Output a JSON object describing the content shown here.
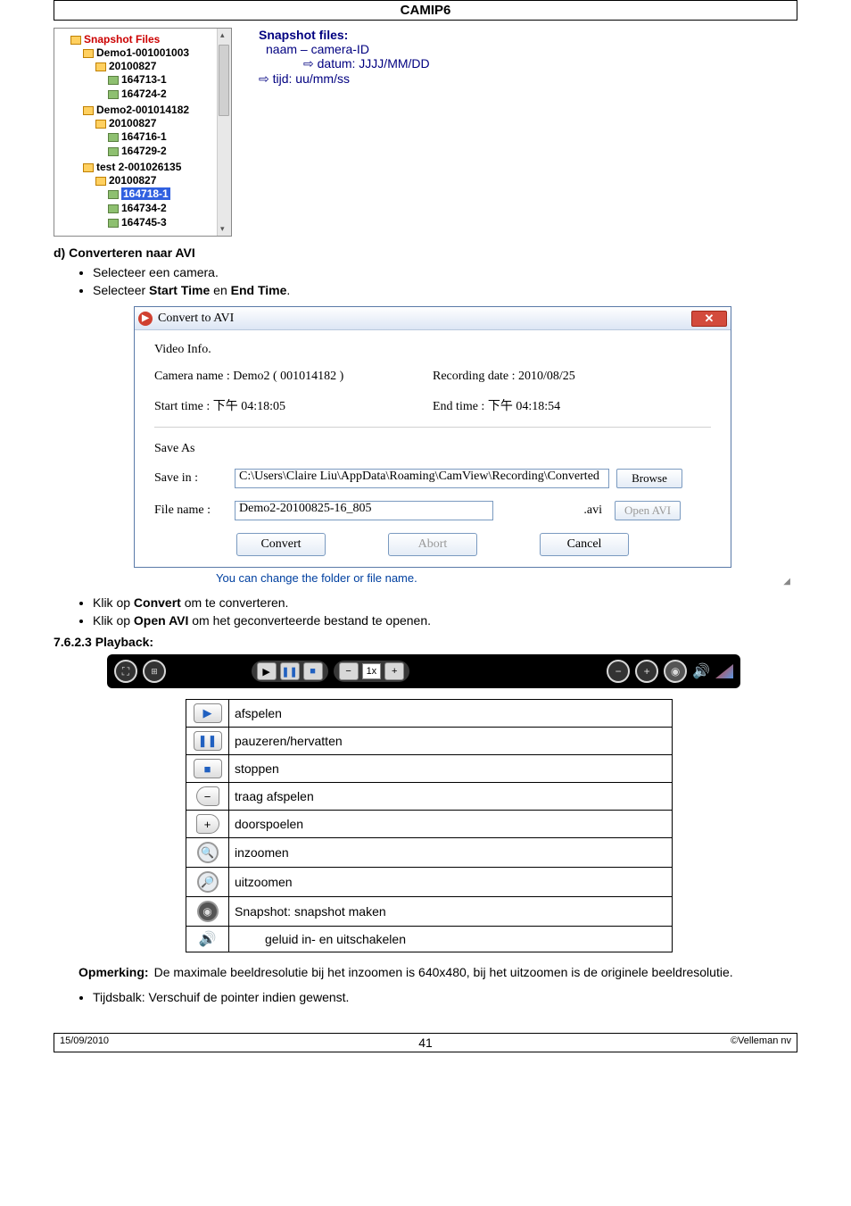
{
  "header": "CAMIP6",
  "tree": {
    "root": "Snapshot Files",
    "nodes": [
      {
        "name": "Demo1-001001003",
        "date": "20100827",
        "files": [
          "164713-1",
          "164724-2"
        ]
      },
      {
        "name": "Demo2-001014182",
        "date": "20100827",
        "files": [
          "164716-1",
          "164729-2"
        ]
      },
      {
        "name": "test 2-001026135",
        "date": "20100827",
        "files": [
          "164718-1",
          "164734-2",
          "164745-3"
        ],
        "selected_file": "164718-1"
      }
    ]
  },
  "snapshot_desc": {
    "title": "Snapshot files:",
    "l1": "naam – camera-ID",
    "l2": "⇨ datum: JJJJ/MM/DD",
    "l3": "⇨ tijd: uu/mm/ss"
  },
  "section_d": "d) Converteren naar AVI",
  "bullets_d": [
    "Selecteer een camera.",
    {
      "pre": "Selecteer ",
      "b1": "Start Time",
      "mid": " en ",
      "b2": "End Time",
      "post": "."
    }
  ],
  "dlg": {
    "title": "Convert to AVI",
    "video_info": "Video Info.",
    "cam_label": "Camera name : Demo2 ( 001014182 )",
    "rec_label": "Recording date : 2010/08/25",
    "start_label": "Start time : 下午 04:18:05",
    "end_label": "End time : 下午 04:18:54",
    "save_as": "Save As",
    "save_in": "Save in :",
    "save_in_val": "C:\\Users\\Claire Liu\\AppData\\Roaming\\CamView\\Recording\\Converted",
    "browse": "Browse",
    "file_name": "File name :",
    "file_name_val": "Demo2-20100825-16_805",
    "ext": ".avi",
    "open_avi": "Open AVI",
    "convert": "Convert",
    "abort": "Abort",
    "cancel": "Cancel",
    "note": "You can change the folder or file name."
  },
  "bullets_after": [
    {
      "pre": "Klik op ",
      "b": "Convert",
      "post": " om te converteren."
    },
    {
      "pre": "Klik op ",
      "b": "Open AVI",
      "post": " om het geconverteerde bestand te openen."
    }
  ],
  "section_playback": "7.6.2.3 Playback:",
  "pbar": {
    "speed": "1x"
  },
  "ptable": [
    {
      "icon": "play",
      "label": "afspelen"
    },
    {
      "icon": "pause",
      "label": "pauzeren/hervatten"
    },
    {
      "icon": "stop",
      "label": "stoppen"
    },
    {
      "icon": "minus",
      "label": "traag afspelen"
    },
    {
      "icon": "plus",
      "label": "doorspoelen"
    },
    {
      "icon": "zoomout",
      "label": "inzoomen"
    },
    {
      "icon": "zoomin",
      "label": "uitzoomen"
    },
    {
      "icon": "camera",
      "label": "Snapshot: snapshot maken"
    },
    {
      "icon": "speaker",
      "label": "geluid in- en uitschakelen"
    }
  ],
  "note": {
    "label": "Opmerking:",
    "text": "De maximale beeldresolutie bij het inzoomen is 640x480, bij het uitzoomen is de originele beeldresolutie."
  },
  "bullet_last": "Tijdsbalk: Verschuif de pointer indien gewenst.",
  "footer": {
    "left": "15/09/2010",
    "center": "41",
    "right": "©Velleman nv"
  }
}
